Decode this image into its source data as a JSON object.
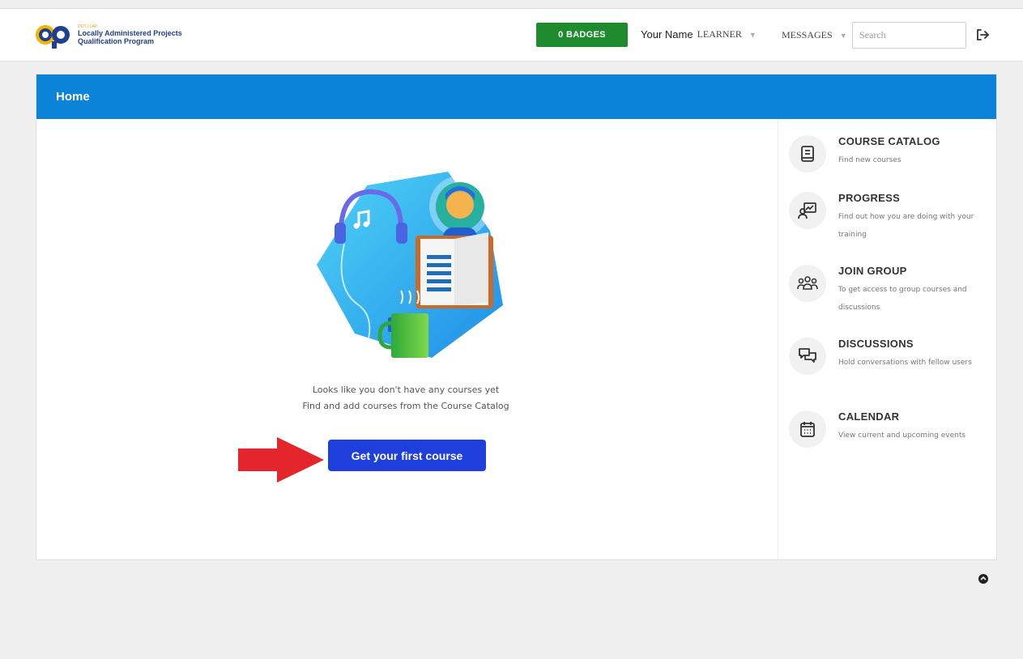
{
  "header": {
    "logo_tiny": "DOT | LAP",
    "logo_line1": "Locally Administered Projects",
    "logo_line2": "Qualification Program",
    "badges_label": "0 BADGES",
    "user_name": "Your Name",
    "user_role": "LEARNER",
    "messages_label": "MESSAGES",
    "search_placeholder": "Search"
  },
  "panel": {
    "title": "Home",
    "empty_line1": "Looks like you don't have any courses yet",
    "empty_line2": "Find and add courses from the Course Catalog",
    "cta_label": "Get your first course"
  },
  "sidebar": {
    "items": [
      {
        "title": "COURSE CATALOG",
        "desc": "Find new courses",
        "icon": "book-icon"
      },
      {
        "title": "PROGRESS",
        "desc": "Find out how you are doing with your training",
        "icon": "progress-chart-icon"
      },
      {
        "title": "JOIN GROUP",
        "desc": "To get access to group courses and discussions",
        "icon": "group-icon"
      },
      {
        "title": "DISCUSSIONS",
        "desc": "Hold conversations with fellow users",
        "icon": "chat-icon"
      },
      {
        "title": "CALENDAR",
        "desc": "View current and upcoming events",
        "icon": "calendar-icon"
      }
    ]
  },
  "colors": {
    "header_blue": "#0a83d8",
    "badge_green": "#1e8c2e",
    "cta_blue": "#1f3fdc",
    "arrow_red": "#e3262b"
  }
}
